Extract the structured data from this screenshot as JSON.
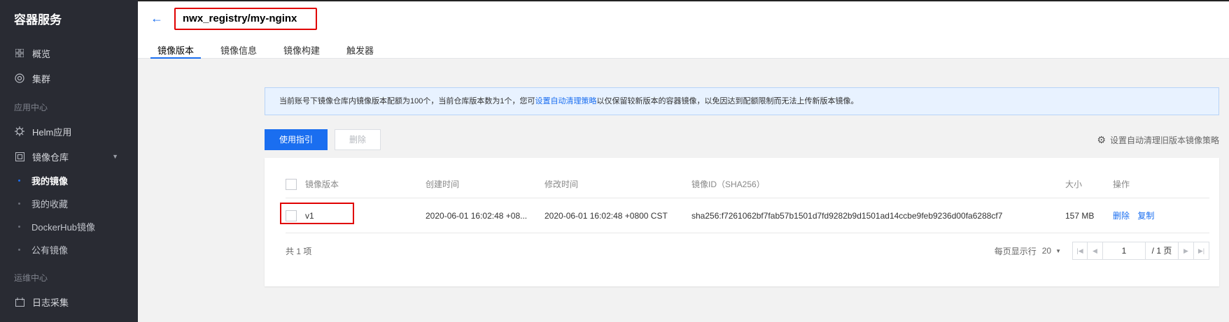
{
  "sidebar": {
    "title": "容器服务",
    "items_top": [
      {
        "label": "概览",
        "icon": "grid-icon"
      },
      {
        "label": "集群",
        "icon": "cluster-icon"
      }
    ],
    "group_app": "应用中心",
    "helm": "Helm应用",
    "registry": "镜像仓库",
    "subitems": [
      "我的镜像",
      "我的收藏",
      "DockerHub镜像",
      "公有镜像"
    ],
    "group_ops": "运维中心",
    "logs": "日志采集"
  },
  "header": {
    "title": "nwx_registry/my-nginx",
    "tabs": [
      "镜像版本",
      "镜像信息",
      "镜像构建",
      "触发器"
    ]
  },
  "notice": {
    "prefix": "当前账号下镜像仓库内镜像版本配额为100个，当前仓库版本数为1个，您可",
    "link": "设置自动清理策略",
    "suffix": "以仅保留较新版本的容器镜像，以免因达到配额限制而无法上传新版本镜像。"
  },
  "toolbar": {
    "guide_label": "使用指引",
    "delete_label": "删除",
    "policy_label": "设置自动清理旧版本镜像策略"
  },
  "table": {
    "headers": [
      "镜像版本",
      "创建时间",
      "修改时间",
      "镜像ID（SHA256）",
      "大小",
      "操作"
    ],
    "rows": [
      {
        "version": "v1",
        "created": "2020-06-01 16:02:48 +08...",
        "modified": "2020-06-01 16:02:48 +0800 CST",
        "image_id": "sha256:f7261062bf7fab57b1501d7fd9282b9d1501ad14ccbe9feb9236d00fa6288cf7",
        "size": "157 MB",
        "ops": [
          "删除",
          "复制"
        ]
      }
    ]
  },
  "footer": {
    "total": "共 1 项",
    "per_page_label": "每页显示行",
    "per_page_value": "20",
    "page_input": "1",
    "page_total": "/ 1 页"
  },
  "colors": {
    "accent": "#1a6ef0",
    "sidebar_bg": "#292b33",
    "highlight": "#e00000"
  }
}
